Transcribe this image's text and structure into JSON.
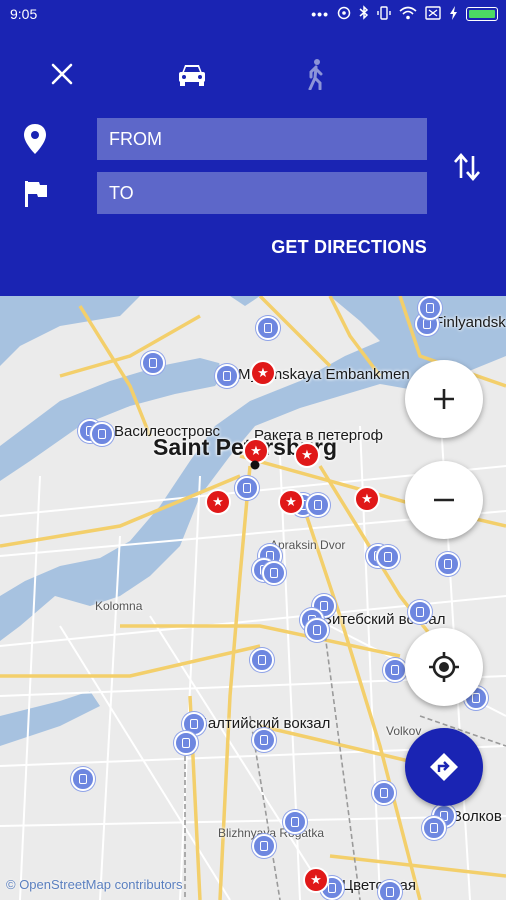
{
  "status_bar": {
    "time": "9:05"
  },
  "form": {
    "from_placeholder": "FROM",
    "to_placeholder": "TO",
    "get_directions_label": "GET DIRECTIONS"
  },
  "map": {
    "labels": {
      "finlyandsky": "Finlyandsk",
      "mytninskaya": "Mytninskaya Embankmen",
      "vasileostrov": "Василеостровс",
      "raketa": "Ракета в петергоф",
      "saint_petersburg": "Saint Petersburg",
      "apraksin": "Apraksin Dvor",
      "kolomna": "Kolomna",
      "vitebsky": "Витебский вокзал",
      "baltiysky": "Балтийский вокзал",
      "volkovo_small": "Volkov",
      "volkovo": "Волков",
      "blizhnyaya": "Blizhnyaya Rogatka",
      "tsvetochnaya": "Цветочная"
    },
    "attribution": "© OpenStreetMap contributors"
  },
  "colors": {
    "header": "#1a24b3",
    "input_bg": "#5d67c9",
    "water": "#a7c2e0",
    "marker_transit": "#6e87e0",
    "marker_poi": "#e01818"
  }
}
